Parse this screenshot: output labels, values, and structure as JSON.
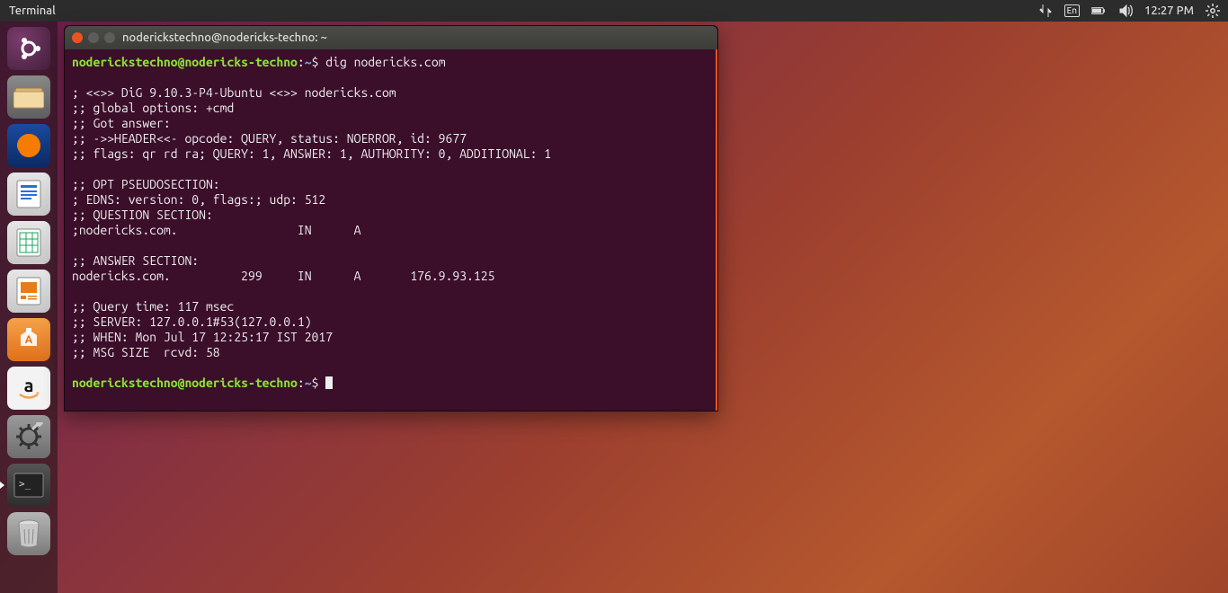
{
  "top_panel": {
    "title": "Terminal",
    "lang": "En",
    "time": "12:27 PM"
  },
  "window": {
    "title": "noderickstechno@nodericks-techno: ~"
  },
  "terminal": {
    "prompt_user": "noderickstechno@nodericks-techno",
    "prompt_path": "~",
    "prompt_symbol": "$",
    "command": "dig nodericks.com",
    "output": "\n; <<>> DiG 9.10.3-P4-Ubuntu <<>> nodericks.com\n;; global options: +cmd\n;; Got answer:\n;; ->>HEADER<<- opcode: QUERY, status: NOERROR, id: 9677\n;; flags: qr rd ra; QUERY: 1, ANSWER: 1, AUTHORITY: 0, ADDITIONAL: 1\n\n;; OPT PSEUDOSECTION:\n; EDNS: version: 0, flags:; udp: 512\n;; QUESTION SECTION:\n;nodericks.com.                 IN      A\n\n;; ANSWER SECTION:\nnodericks.com.          299     IN      A       176.9.93.125\n\n;; Query time: 117 msec\n;; SERVER: 127.0.0.1#53(127.0.0.1)\n;; WHEN: Mon Jul 17 12:25:17 IST 2017\n;; MSG SIZE  rcvd: 58\n"
  },
  "launcher": {
    "items": [
      {
        "name": "ubuntu-dash"
      },
      {
        "name": "files"
      },
      {
        "name": "firefox"
      },
      {
        "name": "writer"
      },
      {
        "name": "calc"
      },
      {
        "name": "impress"
      },
      {
        "name": "software"
      },
      {
        "name": "amazon"
      },
      {
        "name": "settings"
      },
      {
        "name": "terminal"
      },
      {
        "name": "trash"
      }
    ]
  }
}
